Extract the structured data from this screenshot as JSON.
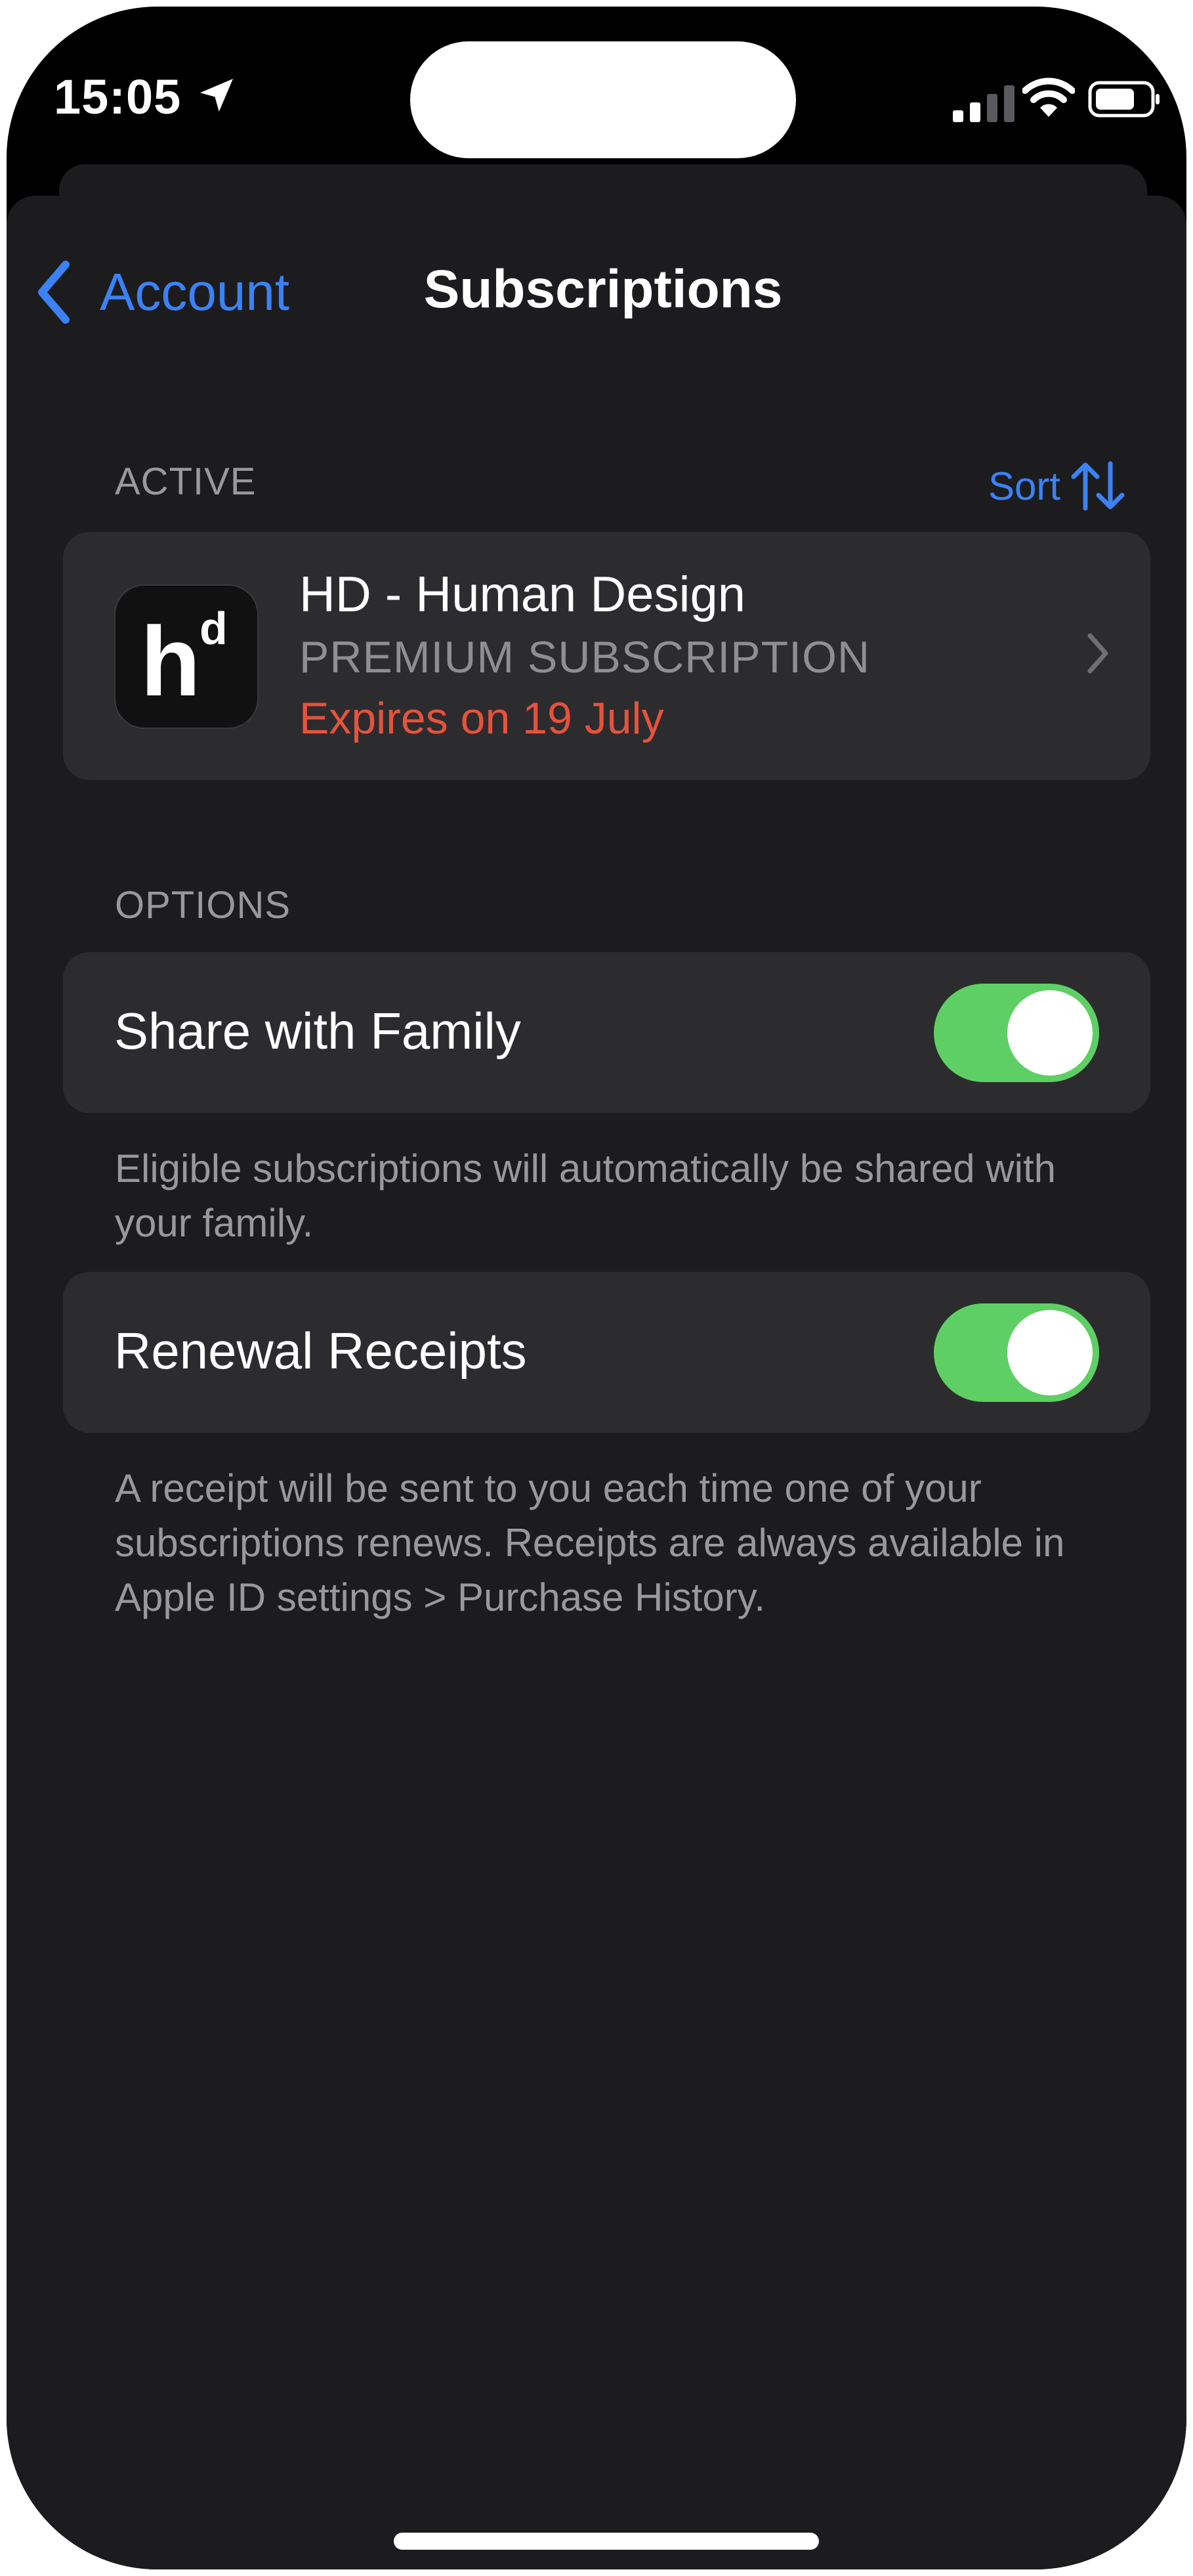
{
  "status_bar": {
    "time": "15:05"
  },
  "nav": {
    "back_label": "Account",
    "title": "Subscriptions"
  },
  "active_section": {
    "label": "ACTIVE",
    "sort_label": "Sort"
  },
  "subscription": {
    "app_icon_letters": {
      "h": "h",
      "d": "d"
    },
    "name": "HD - Human Design",
    "plan": "PREMIUM SUBSCRIPTION",
    "expiry": "Expires on 19 July"
  },
  "options_section": {
    "label": "OPTIONS",
    "share_with_family": {
      "label": "Share with Family",
      "enabled": true,
      "footnote": "Eligible subscriptions will automatically be shared with your family."
    },
    "renewal_receipts": {
      "label": "Renewal Receipts",
      "enabled": true,
      "footnote": "A receipt will be sent to you each time one of your subscriptions renews. Receipts are always available in Apple ID settings > Purchase History."
    }
  },
  "colors": {
    "accent": "#3b82f6",
    "expiry": "#e5533d",
    "toggle_on": "#5ecf64",
    "background": "#1c1c1e",
    "group": "#2c2c2e"
  }
}
